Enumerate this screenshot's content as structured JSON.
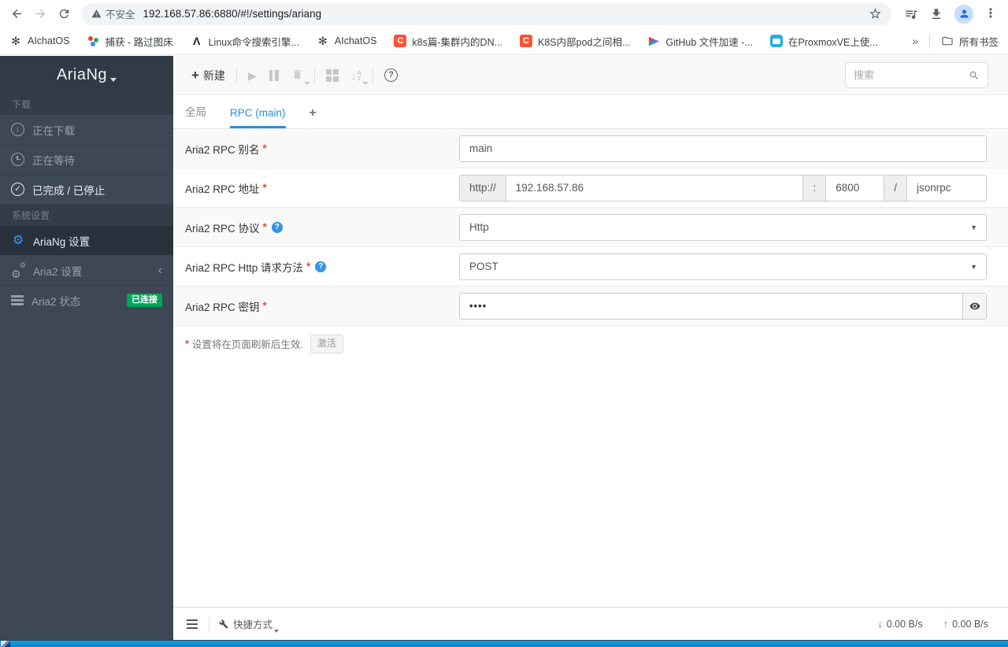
{
  "browser": {
    "security_label": "不安全",
    "url": "192.168.57.86:6880/#!/settings/ariang",
    "bookmarks": [
      {
        "label": "AIchatOS"
      },
      {
        "label": "捕获 - 路过图床"
      },
      {
        "label": "Linux命令搜索引擎..."
      },
      {
        "label": "AIchatOS"
      },
      {
        "label": "k8s篇-集群内的DN..."
      },
      {
        "label": "K8S内部pod之间相..."
      },
      {
        "label": "GitHub 文件加速 -..."
      },
      {
        "label": "在ProxmoxVE上使..."
      }
    ],
    "overflow_label": "»",
    "all_bookmarks_label": "所有书签"
  },
  "sidebar": {
    "logo": "AriaNg",
    "download_section": "下载",
    "system_section": "系统设置",
    "downloading": "正在下载",
    "waiting": "正在等待",
    "stopped": "已完成 / 已停止",
    "ariang_settings": "AriaNg 设置",
    "aria2_settings": "Aria2 设置",
    "aria2_status": "Aria2 状态",
    "connected_badge": "已连接"
  },
  "toolbar": {
    "new_label": "新建",
    "search_placeholder": "搜索"
  },
  "tabs": {
    "global": "全局",
    "rpc_main": "RPC (main)",
    "add": "+"
  },
  "form": {
    "required_mark": "*",
    "alias_label": "Aria2 RPC 别名",
    "alias_value": "main",
    "address_label": "Aria2 RPC 地址",
    "address_prefix": "http://",
    "address_host": "192.168.57.86",
    "address_colon": ":",
    "address_port": "6800",
    "address_slash": "/",
    "address_path": "jsonrpc",
    "protocol_label": "Aria2 RPC 协议",
    "protocol_value": "Http",
    "method_label": "Aria2 RPC Http 请求方法",
    "method_value": "POST",
    "secret_label": "Aria2 RPC 密钥",
    "secret_value": "••••",
    "note_text": "设置将在页面刷新后生效.",
    "activate_label": "激活"
  },
  "statusbar": {
    "shortcuts_label": "快捷方式",
    "download_speed": "0.00 B/s",
    "upload_speed": "0.00 B/s"
  },
  "icons": {
    "plus": "+",
    "play": "▶",
    "menu_dots": "⋮",
    "caret_down": "▼",
    "question": "?",
    "check": "✓",
    "arrow_down": "↓",
    "arrow_up": "↑",
    "chevron_left": "‹",
    "gear": "⚙",
    "sort_a": "A",
    "sort_z": "Z",
    "openai_glyph": "✻",
    "lambda_glyph": "Λ",
    "csdn_glyph": "C"
  },
  "colors": {
    "accent_blue": "#2b8fd9",
    "badge_green": "#00a65a",
    "speed_down_blue": "#2b7cd3",
    "speed_up_green": "#3d9a40",
    "sidebar_bg": "#3d4854",
    "strip_blue": "#0b91d3"
  }
}
